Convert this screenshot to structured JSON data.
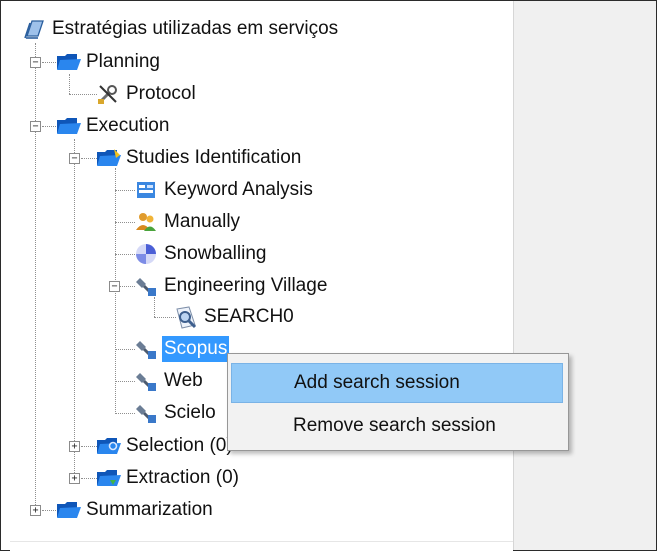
{
  "tree": {
    "root": "Estratégias utilizadas em serviços",
    "planning": "Planning",
    "protocol": "Protocol",
    "execution": "Execution",
    "studies_identification": "Studies Identification",
    "keyword_analysis": "Keyword Analysis",
    "manually": "Manually",
    "snowballing": "Snowballing",
    "engineering_village": "Engineering Village",
    "search0": "SEARCH0",
    "scopus": "Scopus",
    "web": "Web",
    "scielo": "Scielo",
    "selection": "Selection (0)",
    "extraction": "Extraction (0)",
    "summarization": "Summarization"
  },
  "expander": {
    "expanded": "−",
    "collapsed": "+"
  },
  "context_menu": {
    "add_search_session": "Add search session",
    "remove_search_session": "Remove search session"
  },
  "icons": {
    "root": "notebook-icon",
    "folder": "blue-folder-icon",
    "protocol": "wrench-tools-icon",
    "keyword": "keyword-icon",
    "manually": "users-icon",
    "snowballing": "snowball-icon",
    "database": "database-search-icon",
    "search": "search-magnifier-icon"
  },
  "colors": {
    "selection": "#3399ff",
    "menu_hover": "#91c9f7",
    "folder": "#1e6fd9"
  }
}
